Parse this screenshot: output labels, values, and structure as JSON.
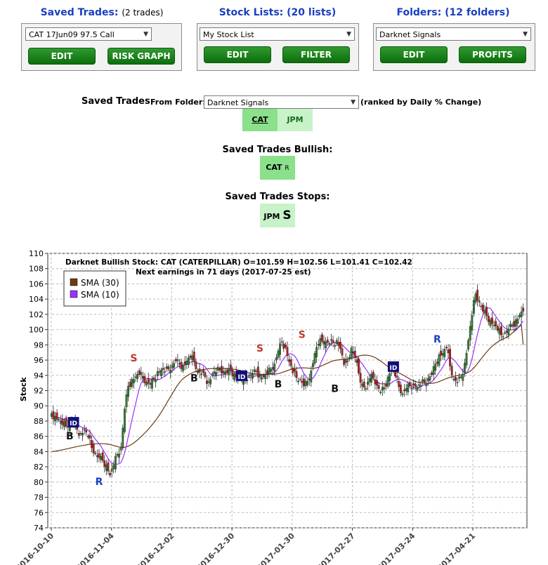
{
  "saved_trades": {
    "title": "Saved Trades:",
    "count": "(2 trades)",
    "selected": "CAT 17Jun09 97.5 Call",
    "edit": "EDIT",
    "risk_graph": "RISK GRAPH"
  },
  "stock_lists": {
    "title": "Stock Lists:",
    "count": "(20 lists)",
    "selected": "My Stock List",
    "edit": "EDIT",
    "filter": "FILTER"
  },
  "folders": {
    "title": "Folders:",
    "count": "(12 folders)",
    "selected": "Darknet Signals",
    "edit": "EDIT",
    "profits": "PROFITS"
  },
  "ranking": {
    "heading": "Saved Trades",
    "from_label": "From Folder:",
    "folder": "Darknet Signals",
    "note": "(ranked by Daily % Change)",
    "tickers": [
      "CAT",
      "JPM"
    ]
  },
  "bullish": {
    "heading": "Saved Trades Bullish:",
    "ticker": "CAT",
    "flag": "R"
  },
  "stops": {
    "heading": "Saved Trades Stops:",
    "ticker": "JPM",
    "flag": "S"
  },
  "colors": {
    "green_btn": "#0d6e0d",
    "title_blue": "#1a3fbf",
    "tile_green": "#c8f2c8",
    "up": "#2e7d32",
    "down": "#b71c1c",
    "sma30": "#6b3a12",
    "sma10": "#9b30ff"
  },
  "chart_data": {
    "type": "candlestick",
    "title": "Darknet Bullish Stock: CAT (CATERPILLAR) O=101.59  H=102.56  L=101.41  C=102.42",
    "subtitle": "Next earnings in 71 days  (2017-07-25 est)",
    "ylabel": "Stock",
    "ylim": [
      74,
      110
    ],
    "yticks": [
      74,
      76,
      78,
      80,
      82,
      84,
      86,
      88,
      90,
      92,
      94,
      96,
      98,
      100,
      102,
      104,
      106,
      108,
      110
    ],
    "xticks": [
      "2016-10-10",
      "2016-11-04",
      "2016-12-02",
      "2016-12-30",
      "2017-01-30",
      "2017-02-27",
      "2017-03-24",
      "2017-04-21"
    ],
    "legend": [
      "SMA (30)",
      "SMA (10)"
    ],
    "close": [
      89,
      88.6,
      88.2,
      87.5,
      87.3,
      87.9,
      87.6,
      86.9,
      86.4,
      86.8,
      85.9,
      84.5,
      83.8,
      83.2,
      82.8,
      82.3,
      80.9,
      82.2,
      83.5,
      84.6,
      89.6,
      92.6,
      93.5,
      93.8,
      94.1,
      93.6,
      93.1,
      92.8,
      93.4,
      94.5,
      94.7,
      94.4,
      94.8,
      95.3,
      95.9,
      95.5,
      95.3,
      95.9,
      96.3,
      95.8,
      94.6,
      94.2,
      93.8,
      93.1,
      94.2,
      94.4,
      94.7,
      94.6,
      94.3,
      94.7,
      94.2,
      93.7,
      93.3,
      93.5,
      94,
      94.2,
      94.6,
      94,
      93.8,
      94.1,
      94.8,
      95.5,
      97.2,
      98.4,
      97.7,
      95.8,
      94.3,
      93.7,
      93.5,
      92.6,
      93.2,
      94.6,
      96.9,
      98.1,
      98.5,
      98.4,
      98.2,
      98.3,
      98.6,
      97.5,
      95.4,
      95.8,
      97.6,
      96.3,
      94.3,
      92.9,
      92.3,
      93.6,
      93.7,
      92.7,
      91.8,
      92.4,
      93.8,
      95.1,
      93.9,
      92.5,
      91.6,
      92.3,
      92.6,
      92.9,
      92.5,
      92.7,
      93.1,
      93.6,
      94.1,
      95.5,
      96.7,
      96.9,
      97.6,
      95.2,
      93.5,
      93.1,
      93.8,
      95.6,
      98.6,
      101.9,
      104.7,
      103.6,
      102.4,
      101.8,
      101.3,
      100.6,
      99.9,
      99.3,
      99.6,
      100.1,
      100.6,
      101.3,
      101.9,
      102.4
    ],
    "sma30_start": 84,
    "sma30_end": 98,
    "annotations": [
      {
        "label": "B",
        "index": 10,
        "value": 85.6
      },
      {
        "label": "ID",
        "index": 12,
        "value": 87.8
      },
      {
        "label": "R",
        "index": 26,
        "value": 79.6
      },
      {
        "label": "S",
        "index": 45,
        "value": 95.8
      },
      {
        "label": "B",
        "index": 78,
        "value": 93.2
      },
      {
        "label": "ID",
        "index": 104,
        "value": 93.9
      },
      {
        "label": "S",
        "index": 114,
        "value": 97.1
      },
      {
        "label": "B",
        "index": 124,
        "value": 92.4
      },
      {
        "label": "S",
        "index": 137,
        "value": 98.9
      },
      {
        "label": "B",
        "index": 155,
        "value": 91.8
      },
      {
        "label": "ID",
        "index": 187,
        "value": 95.1
      },
      {
        "label": "R",
        "index": 211,
        "value": 98.3
      }
    ]
  }
}
